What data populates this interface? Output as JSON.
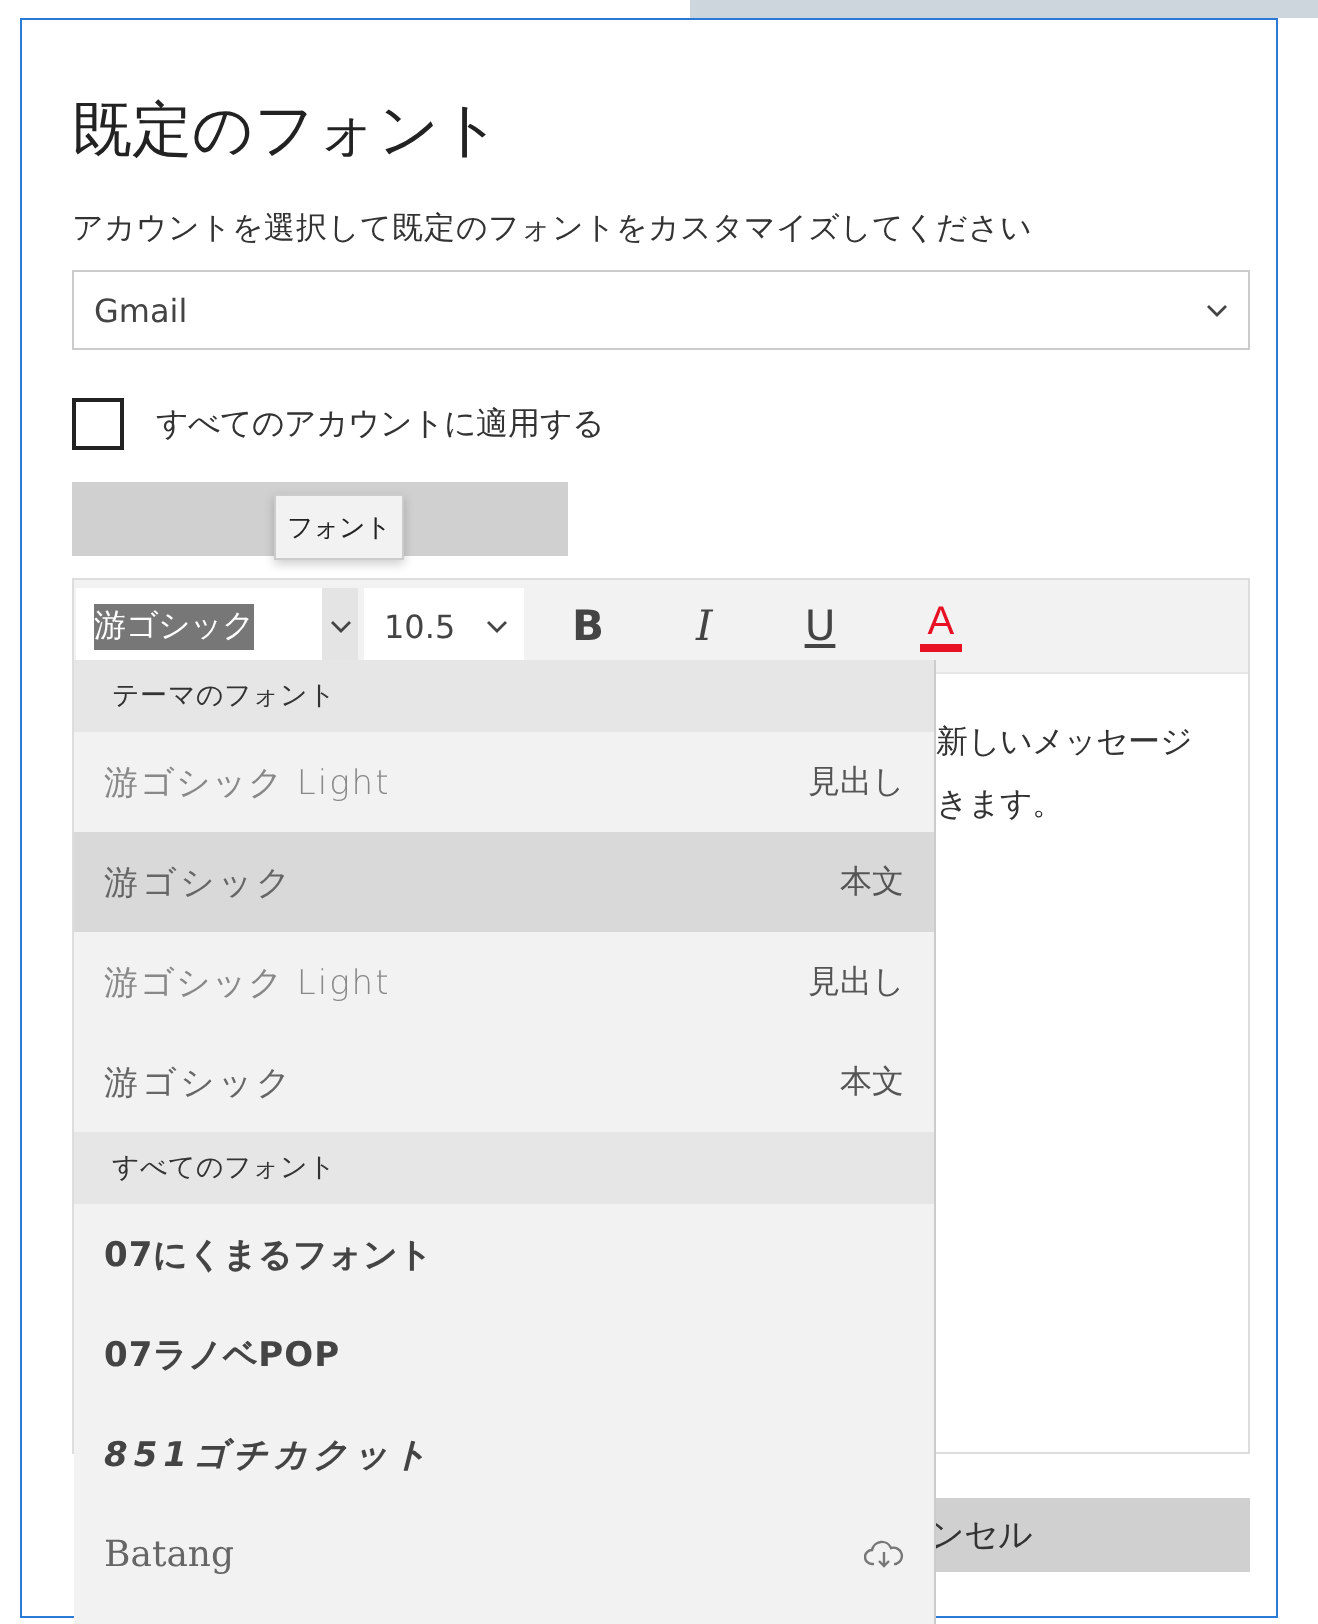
{
  "title": "既定のフォント",
  "subtitle": "アカウントを選択して既定のフォントをカスタマイズしてください",
  "account_select": {
    "value": "Gmail"
  },
  "apply_all": {
    "label": "すべてのアカウントに適用する",
    "checked": false
  },
  "tooltip": {
    "text": "フォント"
  },
  "toolbar": {
    "font_value": "游ゴシック",
    "size_value": "10.5",
    "bold": "B",
    "italic": "I",
    "underline": "U",
    "font_color": "A",
    "color": "#e81123"
  },
  "editor_lines": [
    "新しいメッセージ",
    "きます。"
  ],
  "cancel_button": "ンセル",
  "font_menu": [
    {
      "header": "テーマのフォント",
      "items": [
        {
          "name": "游ゴシック Light",
          "tag": "見出し",
          "kind": "light",
          "selected": false,
          "downloadable": false
        },
        {
          "name": "游ゴシック",
          "tag": "本文",
          "kind": "regular",
          "selected": true,
          "downloadable": false
        },
        {
          "name": "游ゴシック Light",
          "tag": "見出し",
          "kind": "light",
          "selected": false,
          "downloadable": false
        },
        {
          "name": "游ゴシック",
          "tag": "本文",
          "kind": "regular",
          "selected": false,
          "downloadable": false
        }
      ]
    },
    {
      "header": "すべてのフォント",
      "items": [
        {
          "name": "07にくまるフォント",
          "kind": "heavy",
          "selected": false,
          "downloadable": false
        },
        {
          "name": "07ラノベPOP",
          "kind": "heavy",
          "selected": false,
          "downloadable": false
        },
        {
          "name": "851ゴチカクット",
          "kind": "slanted",
          "selected": false,
          "downloadable": false
        },
        {
          "name": "Batang",
          "kind": "serif",
          "selected": false,
          "downloadable": true
        }
      ]
    }
  ]
}
